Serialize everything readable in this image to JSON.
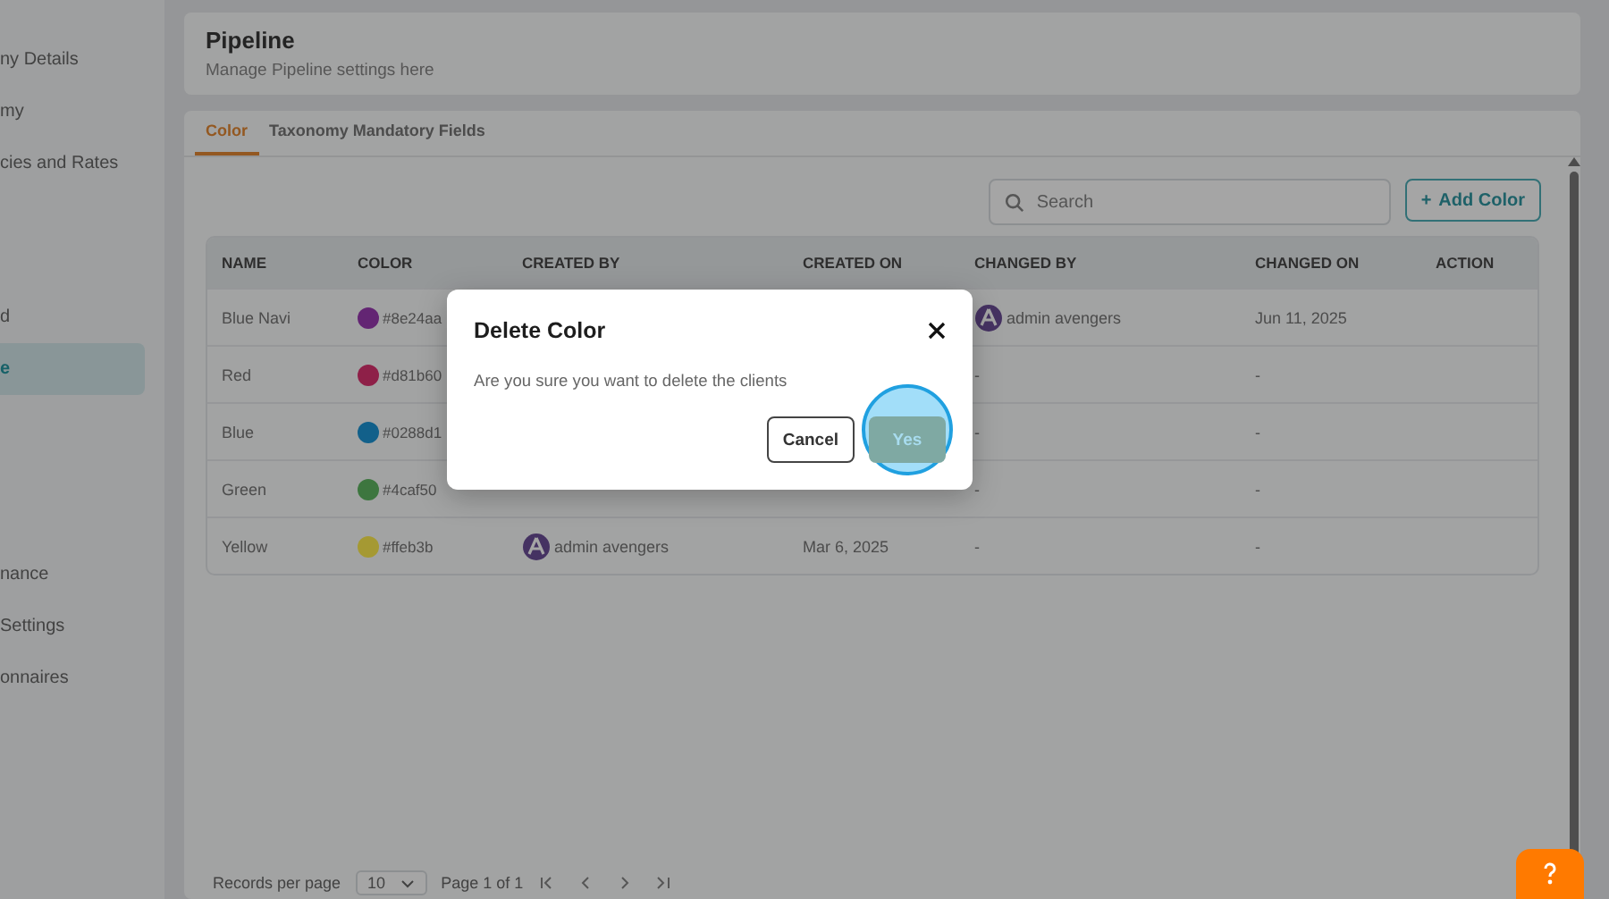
{
  "sidebar": {
    "items": [
      {
        "label": "ny Details",
        "selected": false
      },
      {
        "label": "my",
        "selected": false
      },
      {
        "label": "cies and Rates",
        "selected": false
      },
      {
        "label": "d",
        "selected": false
      },
      {
        "label": "e",
        "selected": true
      },
      {
        "label": "nance",
        "selected": false
      },
      {
        "label": "Settings",
        "selected": false
      },
      {
        "label": "onnaires",
        "selected": false
      }
    ]
  },
  "header": {
    "title": "Pipeline",
    "subtitle": "Manage Pipeline settings here"
  },
  "tabs": [
    {
      "label": "Color",
      "selected": true
    },
    {
      "label": "Taxonomy Mandatory Fields",
      "selected": false
    }
  ],
  "search": {
    "placeholder": "Search"
  },
  "add_button": {
    "icon": "+",
    "label": "Add Color"
  },
  "table": {
    "columns": [
      "NAME",
      "COLOR",
      "CREATED BY",
      "CREATED ON",
      "CHANGED BY",
      "CHANGED ON",
      "ACTION"
    ],
    "rows": [
      {
        "name": "Blue Navi",
        "hex": "#8e24aa",
        "changed_by": "admin avengers",
        "changed_on": "Jun 11, 2025"
      },
      {
        "name": "Red",
        "hex": "#d81b60",
        "changed_by": "-",
        "changed_on": "-"
      },
      {
        "name": "Blue",
        "hex": "#0288d1",
        "changed_by": "-",
        "changed_on": "-"
      },
      {
        "name": "Green",
        "hex": "#4caf50",
        "changed_by": "-",
        "changed_on": "-"
      },
      {
        "name": "Yellow",
        "hex": "#ffeb3b",
        "created_by": "admin avengers",
        "created_on": "Mar 6, 2025",
        "changed_by": "-",
        "changed_on": "-"
      }
    ]
  },
  "pagination": {
    "label": "Records per page",
    "per_page": "10",
    "page": "Page 1 of 1"
  },
  "dialog": {
    "title": "Delete Color",
    "message": "Are you sure you want to delete the clients",
    "buttons": [
      {
        "kind": "secondary",
        "label": "Cancel"
      },
      {
        "kind": "primary",
        "label": "Yes"
      }
    ]
  }
}
